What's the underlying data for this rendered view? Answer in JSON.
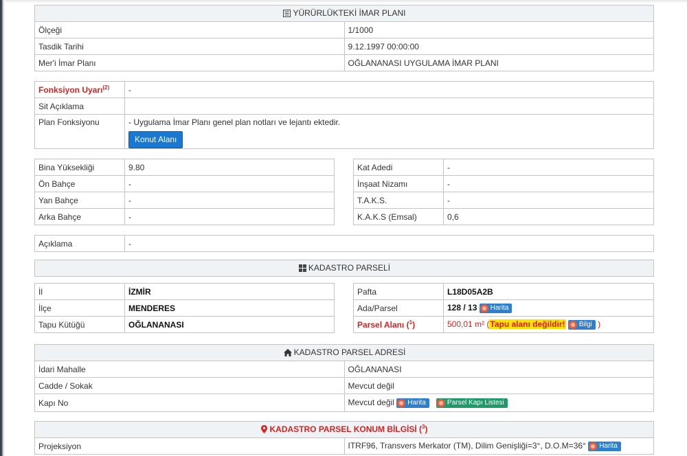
{
  "imar_plani": {
    "header": "YÜRÜRLÜKTEKİ İMAR PLANI",
    "rows": [
      {
        "label": "Ölçeği",
        "value": "1/1000"
      },
      {
        "label": "Tasdik Tarihi",
        "value": "9.12.1997 00:00:00"
      },
      {
        "label": "Mer'i İmar Planı",
        "value": "OĞLANANASI UYGULAMA İMAR PLANI"
      }
    ]
  },
  "fonksiyon": {
    "uyari_label": "Fonksiyon Uyarı",
    "uyari_sup": "2",
    "uyari_value": "-",
    "sit_label": "Sit Açıklama",
    "sit_value": "",
    "plan_label": "Plan Fonksiyonu",
    "plan_note": "- Uygulama İmar Planı genel plan notları ve lejantı ektedir.",
    "plan_button": "Konut Alanı"
  },
  "yapilasma_left": [
    {
      "label": "Bina Yüksekliği",
      "value": "9.80"
    },
    {
      "label": "Ön Bahçe",
      "value": "-"
    },
    {
      "label": "Yan Bahçe",
      "value": "-"
    },
    {
      "label": "Arka Bahçe",
      "value": "-"
    }
  ],
  "yapilasma_right": [
    {
      "label": "Kat Adedi",
      "value": "-"
    },
    {
      "label": "İnşaat Nizamı",
      "value": "-"
    },
    {
      "label": "T.A.K.S.",
      "value": "-"
    },
    {
      "label": "K.A.K.S (Emsal)",
      "value": "0,6"
    }
  ],
  "aciklama": {
    "label": "Açıklama",
    "value": "-"
  },
  "kadastro": {
    "header": "KADASTRO PARSELİ",
    "left": [
      {
        "label": "İl",
        "value": "İZMİR"
      },
      {
        "label": "İlçe",
        "value": "MENDERES"
      },
      {
        "label": "Tapu Kütüğü",
        "value": "OĞLANANASI"
      }
    ],
    "pafta_label": "Pafta",
    "pafta_value": "L18D05A2B",
    "ada_label": "Ada/Parsel",
    "ada_value": "128 / 13",
    "harita_label": "Harita",
    "alan_label": "Parsel Alanı",
    "alan_sup": "1",
    "alan_value": "500,01 m²",
    "alan_open": "(",
    "alan_warning": "Tapu alanı değildir!",
    "bilgi_label": "Bilgi",
    "alan_close": ")"
  },
  "adres": {
    "header": "KADASTRO PARSEL ADRESİ",
    "mahalle_label": "İdari Mahalle",
    "mahalle_value": "OĞLANANASI",
    "cadde_label": "Cadde / Sokak",
    "cadde_value": "Mevcut değil",
    "kapi_label": "Kapı No",
    "kapi_value": "Mevcut değil",
    "harita_label": "Harita",
    "liste_label": "Parsel Kapı Listesi"
  },
  "konum": {
    "header": "KADASTRO PARSEL KONUM BİLGİSİ",
    "header_sup": "3",
    "proj_label": "Projeksiyon",
    "proj_value": "ITRF96, Transvers Merkator (TM), Dilim Genişliği=3°, D.O.M=36°",
    "harita_label": "Harita"
  },
  "colors": {
    "accent_blue": "#1a78d2",
    "warning_red": "#dd1f1f",
    "warning_yellow": "#ffe300",
    "header_bg": "#f0f3f6",
    "border": "#c4c4c4"
  }
}
